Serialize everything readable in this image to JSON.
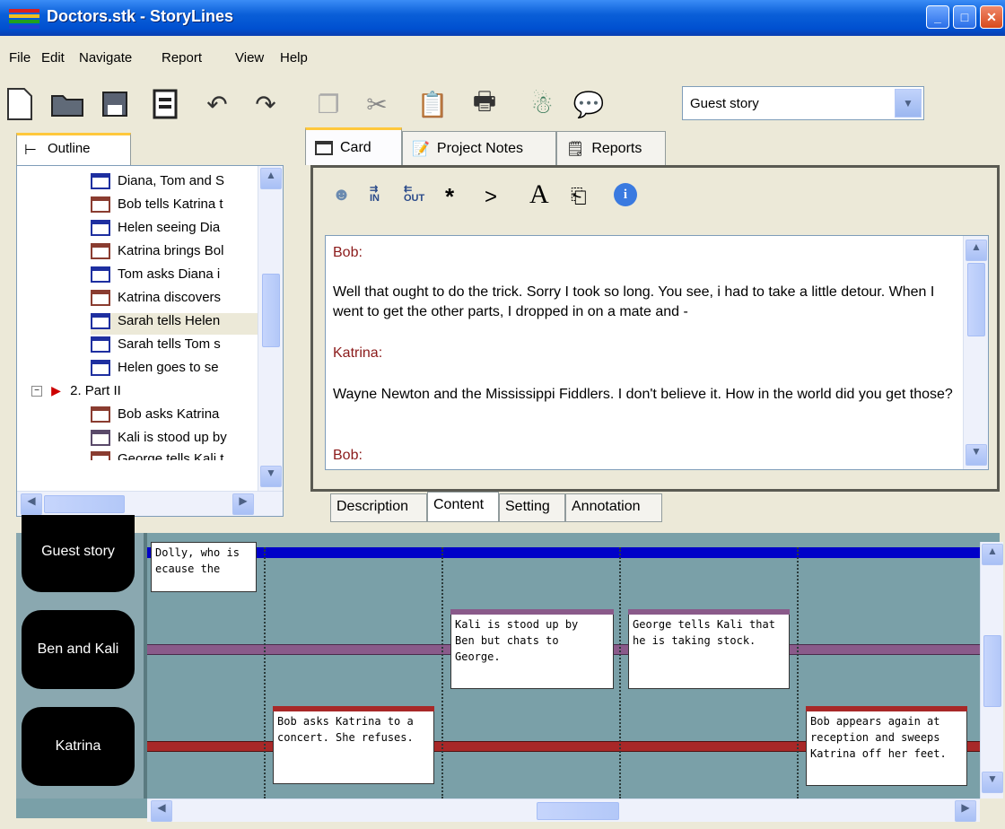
{
  "window": {
    "title": "Doctors.stk - StoryLines"
  },
  "menu": [
    "File",
    "Edit",
    "Navigate",
    "Report",
    "View",
    "Help"
  ],
  "toolbar": {
    "story_select": "Guest story"
  },
  "outline": {
    "tab_label": "Outline",
    "items": [
      "Diana, Tom and S",
      "Bob tells Katrina t",
      "Helen seeing Dia",
      "Katrina brings Bol",
      "Tom asks Diana i",
      "Katrina discovers",
      "Sarah tells Helen",
      "Sarah tells Tom s",
      "Helen goes to se",
      "2. Part II",
      "Bob asks Katrina",
      "Kali is stood up by",
      "George tells Kali t"
    ]
  },
  "tabs": {
    "card": "Card",
    "project_notes": "Project Notes",
    "reports": "Reports"
  },
  "card_toolbar": {
    "star": "*",
    "gt": ">",
    "font": "A",
    "in": "IN",
    "out": "OUT"
  },
  "content": {
    "speaker1": "Bob:",
    "line1": "Well that ought to do the trick. Sorry I took so long. You see, i had to take a little detour. When I went to get the other parts, I dropped in on a mate and -",
    "speaker2": "Katrina:",
    "line2": "Wayne Newton and the Mississippi Fiddlers. I don't believe it. How in the world did you get those?",
    "speaker3": "Bob:"
  },
  "bottom_tabs": {
    "description": "Description",
    "content": "Content",
    "setting": "Setting",
    "annotation": "Annotation"
  },
  "timeline": {
    "lanes": [
      "Guest story",
      "Ben and Kali",
      "Katrina"
    ],
    "scenes": {
      "s1": "Dolly, who is\necause the",
      "s2": "Kali is stood up by\nBen but chats to\nGeorge.",
      "s3": "George tells Kali that\nhe is taking stock.",
      "s4": "Bob asks Katrina to a\nconcert. She refuses.",
      "s5": "Bob appears again at\nreception and sweeps\nKatrina off her feet."
    }
  },
  "colors": {
    "guest": "#0000c8",
    "ben_kali": "#8a5a8a",
    "katrina": "#a82828"
  }
}
